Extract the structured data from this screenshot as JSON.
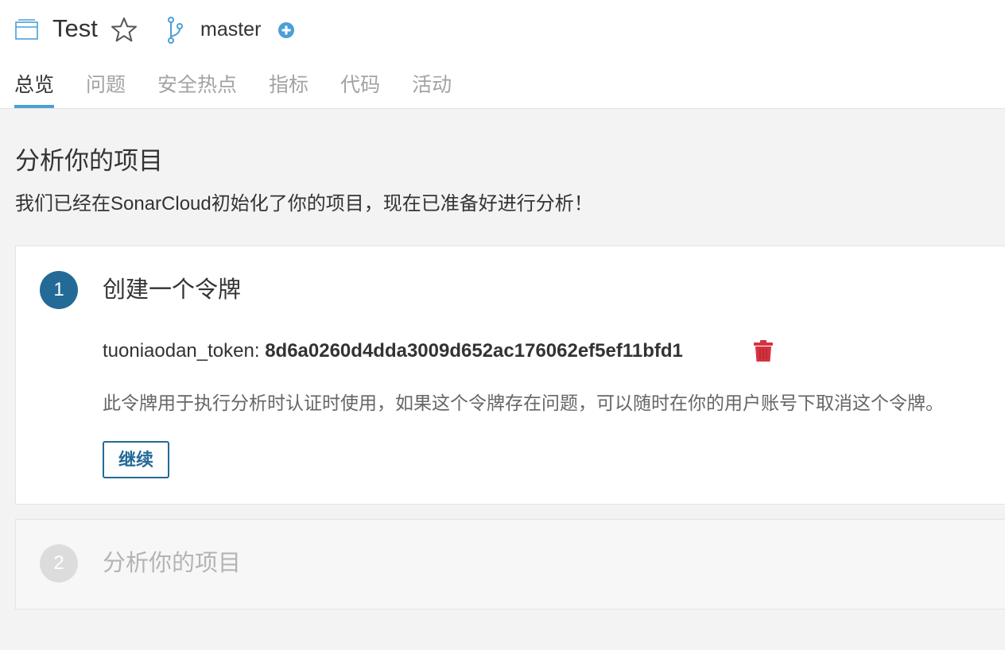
{
  "header": {
    "project_name": "Test",
    "branch_name": "master",
    "icons": {
      "project": "project-window-icon",
      "star": "star-outline-icon",
      "branch": "git-branch-icon",
      "add": "plus-circle-icon"
    }
  },
  "tabs": [
    {
      "label": "总览",
      "active": true
    },
    {
      "label": "问题",
      "active": false
    },
    {
      "label": "安全热点",
      "active": false
    },
    {
      "label": "指标",
      "active": false
    },
    {
      "label": "代码",
      "active": false
    },
    {
      "label": "活动",
      "active": false
    }
  ],
  "main": {
    "title": "分析你的项目",
    "subtitle": "我们已经在SonarCloud初始化了你的项目，现在已准备好进行分析！"
  },
  "steps": [
    {
      "number": "1",
      "title": "创建一个令牌",
      "token_label": "tuoniaodan_token: ",
      "token_value": "8d6a0260d4dda3009d652ac176062ef5ef11bfd1",
      "description": "此令牌用于执行分析时认证时使用，如果这个令牌存在问题，可以随时在你的用户账号下取消这个令牌。",
      "continue_label": "继续"
    },
    {
      "number": "2",
      "title": "分析你的项目"
    }
  ],
  "colors": {
    "accent": "#236a97",
    "tab_underline": "#4b9fd5",
    "delete": "#d4333f",
    "inactive_step": "#dcdcdc"
  }
}
